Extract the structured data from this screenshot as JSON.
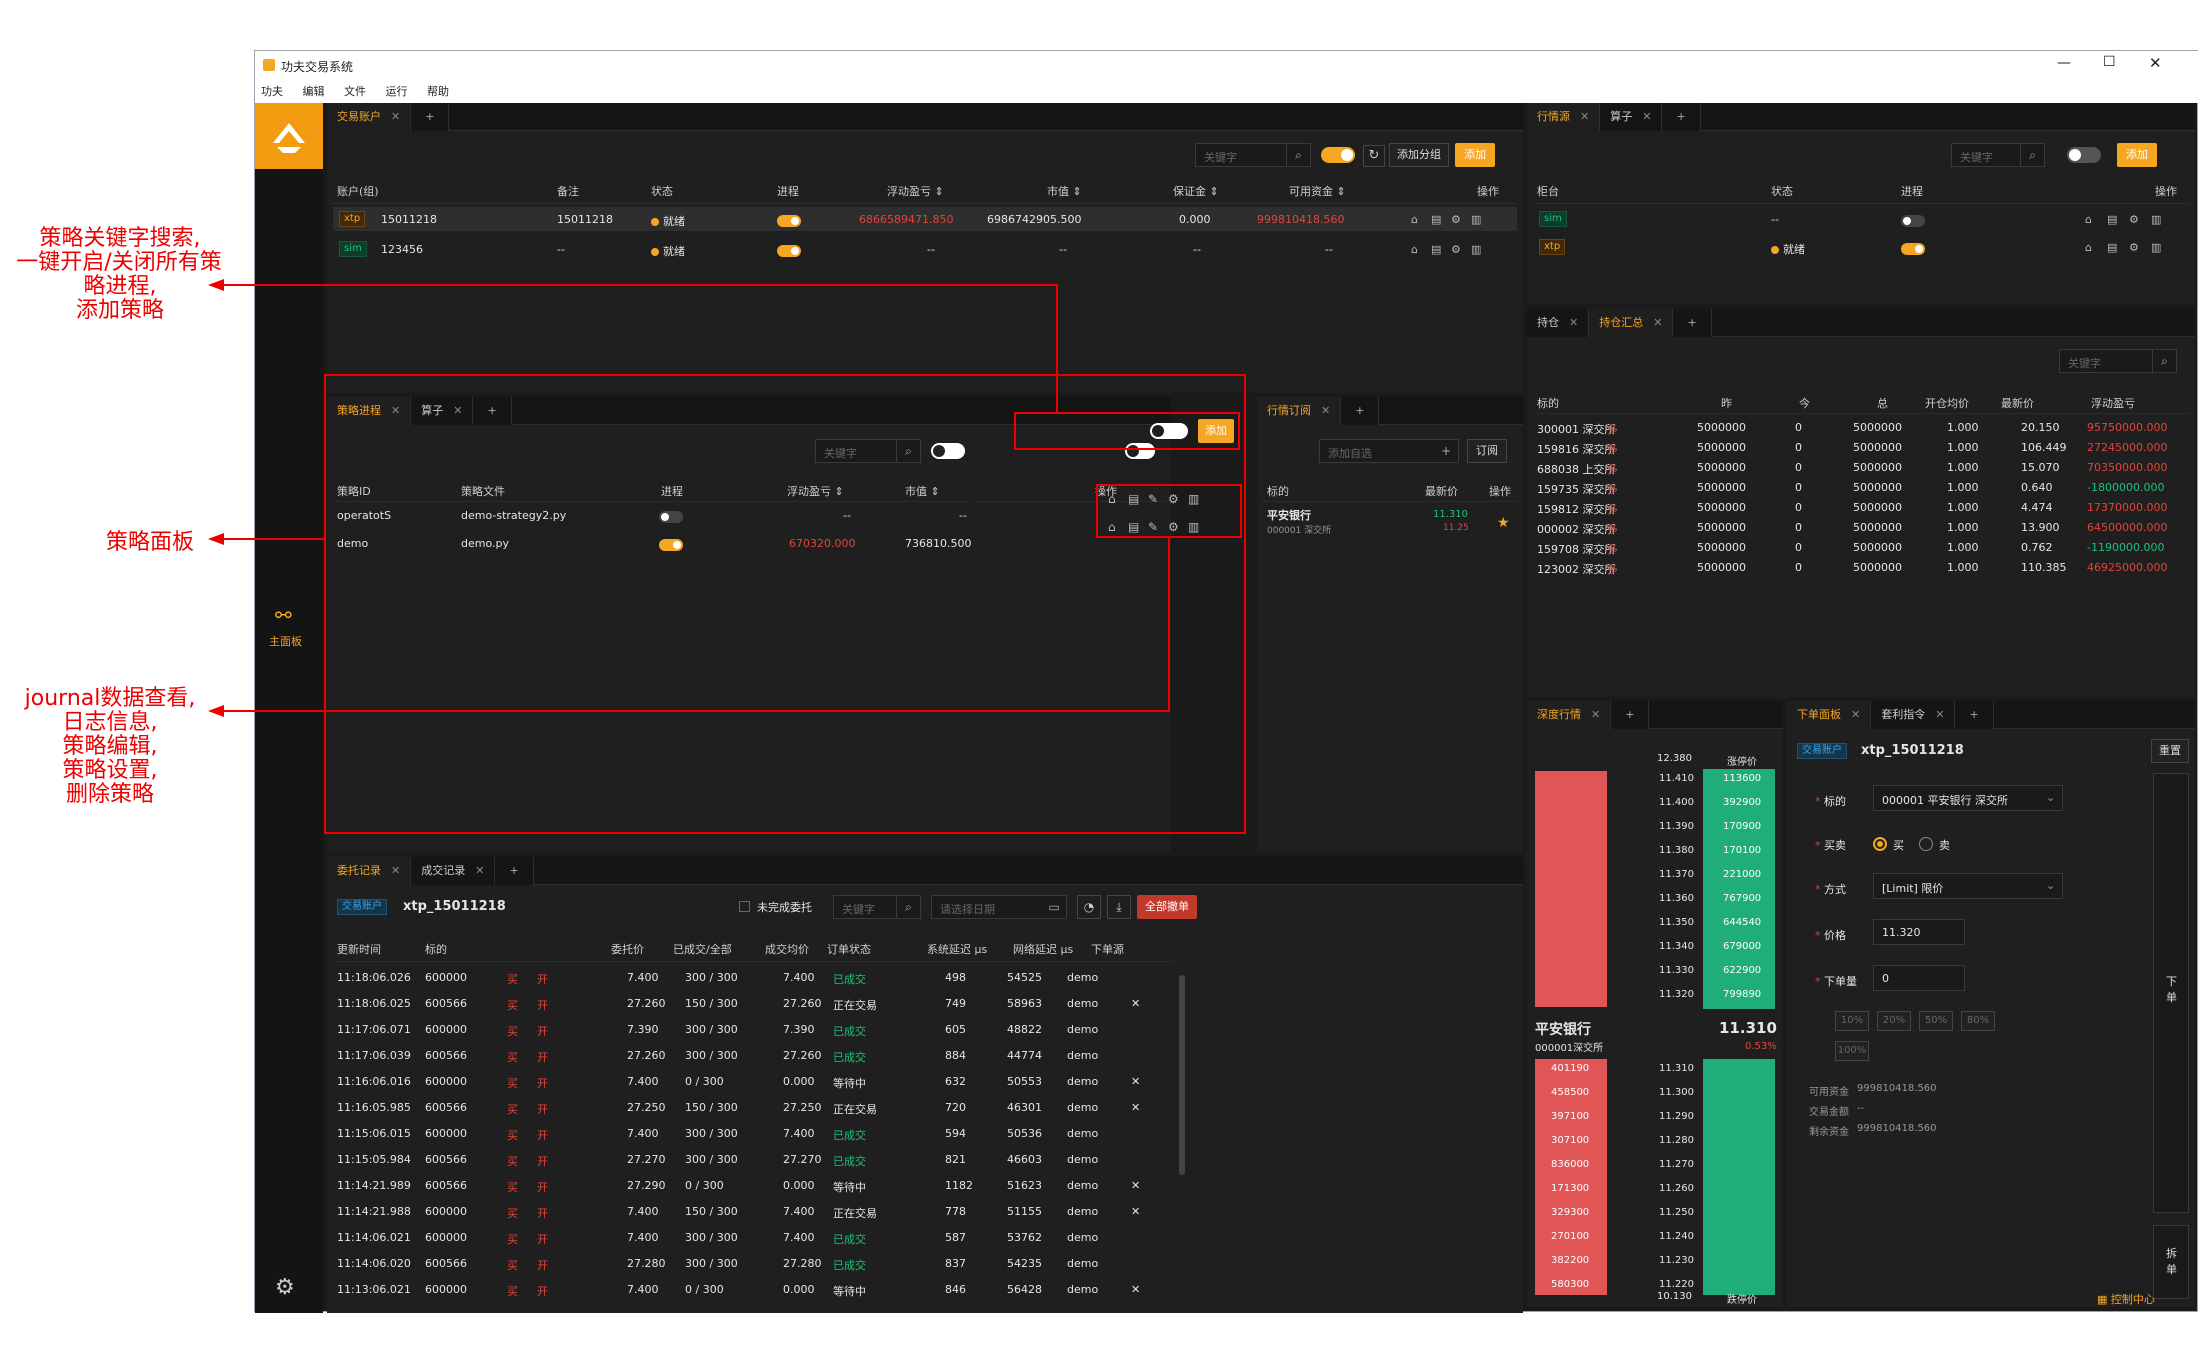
{
  "window": {
    "title": "功夫交易系统",
    "menu": [
      "功夫",
      "编辑",
      "文件",
      "运行",
      "帮助"
    ]
  },
  "sidebar": {
    "main_label": "主面板"
  },
  "accounts": {
    "tabs": [
      "交易账户",
      "+"
    ],
    "search_placeholder": "关键字",
    "add_group": "添加分组",
    "add": "添加",
    "columns": [
      "账户(组)",
      "备注",
      "状态",
      "进程",
      "浮动盈亏 ⇕",
      "市值 ⇕",
      "保证金 ⇕",
      "可用资金 ⇕",
      "操作"
    ],
    "rows": [
      {
        "tag": "xtp",
        "id": "15011218",
        "note": "15011218",
        "status": "就绪",
        "pnl": "6866589471.850",
        "mv": "6986742905.500",
        "margin": "0.000",
        "avail": "999810418.560"
      },
      {
        "tag": "sim",
        "id": "123456",
        "note": "--",
        "status": "就绪",
        "pnl": "--",
        "mv": "--",
        "margin": "--",
        "avail": "--"
      }
    ]
  },
  "md_sources": {
    "tabs": [
      "行情源",
      "算子",
      "+"
    ],
    "search_placeholder": "关键字",
    "add": "添加",
    "columns": [
      "柜台",
      "状态",
      "进程",
      "操作"
    ],
    "rows": [
      {
        "tag": "sim",
        "status": "--"
      },
      {
        "tag": "xtp",
        "status": "就绪"
      }
    ]
  },
  "strategy": {
    "tabs": [
      "策略进程",
      "算子",
      "+"
    ],
    "search_placeholder": "关键字",
    "add": "添加",
    "columns": [
      "策略ID",
      "策略文件",
      "进程",
      "浮动盈亏 ⇕",
      "市值 ⇕",
      "操作"
    ],
    "rows": [
      {
        "id": "operatotS",
        "file": "demo-strategy2.py",
        "pnl": "--",
        "mv": "--"
      },
      {
        "id": "demo",
        "file": "demo.py",
        "pnl": "670320.000",
        "mv": "736810.500"
      }
    ]
  },
  "subscription": {
    "tabs": [
      "行情订阅",
      "+"
    ],
    "add_placeholder": "添加自选",
    "subscribe": "订阅",
    "columns": [
      "标的",
      "最新价",
      "操作"
    ],
    "row": {
      "name": "平安银行",
      "code": "000001 深交所",
      "price": "11.310",
      "pct": "11.25"
    }
  },
  "positions": {
    "tabs": [
      "持仓",
      "持仓汇总",
      "+"
    ],
    "search_placeholder": "关键字",
    "columns": [
      "标的",
      "昨",
      "今",
      "总",
      "开仓均价",
      "最新价",
      "浮动盈亏"
    ],
    "rows": [
      {
        "sym": "300001 深交所",
        "side": "多",
        "y": "5000000",
        "t": "0",
        "total": "5000000",
        "avg": "1.000",
        "last": "20.150",
        "pnl": "95750000.000"
      },
      {
        "sym": "159816 深交所",
        "side": "多",
        "y": "5000000",
        "t": "0",
        "total": "5000000",
        "avg": "1.000",
        "last": "106.449",
        "pnl": "27245000.000"
      },
      {
        "sym": "688038 上交所",
        "side": "多",
        "y": "5000000",
        "t": "0",
        "total": "5000000",
        "avg": "1.000",
        "last": "15.070",
        "pnl": "70350000.000"
      },
      {
        "sym": "159735 深交所",
        "side": "多",
        "y": "5000000",
        "t": "0",
        "total": "5000000",
        "avg": "1.000",
        "last": "0.640",
        "pnl": "-1800000.000"
      },
      {
        "sym": "159812 深交所",
        "side": "多",
        "y": "5000000",
        "t": "0",
        "total": "5000000",
        "avg": "1.000",
        "last": "4.474",
        "pnl": "17370000.000"
      },
      {
        "sym": "000002 深交所",
        "side": "多",
        "y": "5000000",
        "t": "0",
        "total": "5000000",
        "avg": "1.000",
        "last": "13.900",
        "pnl": "64500000.000"
      },
      {
        "sym": "159708 深交所",
        "side": "多",
        "y": "5000000",
        "t": "0",
        "total": "5000000",
        "avg": "1.000",
        "last": "0.762",
        "pnl": "-1190000.000"
      },
      {
        "sym": "123002 深交所",
        "side": "多",
        "y": "5000000",
        "t": "0",
        "total": "5000000",
        "avg": "1.000",
        "last": "110.385",
        "pnl": "46925000.000"
      }
    ]
  },
  "orders": {
    "tabs": [
      "委托记录",
      "成交记录",
      "+"
    ],
    "account_tag": "交易账户",
    "account": "xtp_15011218",
    "unfinished": "未完成委托",
    "search_placeholder": "关键字",
    "date_placeholder": "请选择日期",
    "cancel_all": "全部撤单",
    "columns": [
      "更新时间",
      "标的",
      "委托价",
      "已成交/全部",
      "成交均价",
      "订单状态",
      "系统延迟 μs",
      "网络延迟 μs",
      "下单源"
    ],
    "rows": [
      {
        "time": "11:18:06.026",
        "sym": "600000",
        "price": "7.400",
        "fill": "300 / 300",
        "avg": "7.400",
        "status": "已成交",
        "sys": "498",
        "net": "54525",
        "src": "demo",
        "x": ""
      },
      {
        "time": "11:18:06.025",
        "sym": "600566",
        "price": "27.260",
        "fill": "150 / 300",
        "avg": "27.260",
        "status": "正在交易",
        "sys": "749",
        "net": "58963",
        "src": "demo",
        "x": "✕"
      },
      {
        "time": "11:17:06.071",
        "sym": "600000",
        "price": "7.390",
        "fill": "300 / 300",
        "avg": "7.390",
        "status": "已成交",
        "sys": "605",
        "net": "48822",
        "src": "demo",
        "x": ""
      },
      {
        "time": "11:17:06.039",
        "sym": "600566",
        "price": "27.260",
        "fill": "300 / 300",
        "avg": "27.260",
        "status": "已成交",
        "sys": "884",
        "net": "44774",
        "src": "demo",
        "x": ""
      },
      {
        "time": "11:16:06.016",
        "sym": "600000",
        "price": "7.400",
        "fill": "0 / 300",
        "avg": "0.000",
        "status": "等待中",
        "sys": "632",
        "net": "50553",
        "src": "demo",
        "x": "✕"
      },
      {
        "time": "11:16:05.985",
        "sym": "600566",
        "price": "27.250",
        "fill": "150 / 300",
        "avg": "27.250",
        "status": "正在交易",
        "sys": "720",
        "net": "46301",
        "src": "demo",
        "x": "✕"
      },
      {
        "time": "11:15:06.015",
        "sym": "600000",
        "price": "7.400",
        "fill": "300 / 300",
        "avg": "7.400",
        "status": "已成交",
        "sys": "594",
        "net": "50536",
        "src": "demo",
        "x": ""
      },
      {
        "time": "11:15:05.984",
        "sym": "600566",
        "price": "27.270",
        "fill": "300 / 300",
        "avg": "27.270",
        "status": "已成交",
        "sys": "821",
        "net": "46603",
        "src": "demo",
        "x": ""
      },
      {
        "time": "11:14:21.989",
        "sym": "600566",
        "price": "27.290",
        "fill": "0 / 300",
        "avg": "0.000",
        "status": "等待中",
        "sys": "1182",
        "net": "51623",
        "src": "demo",
        "x": "✕"
      },
      {
        "time": "11:14:21.988",
        "sym": "600000",
        "price": "7.400",
        "fill": "150 / 300",
        "avg": "7.400",
        "status": "正在交易",
        "sys": "778",
        "net": "51155",
        "src": "demo",
        "x": "✕"
      },
      {
        "time": "11:14:06.021",
        "sym": "600000",
        "price": "7.400",
        "fill": "300 / 300",
        "avg": "7.400",
        "status": "已成交",
        "sys": "587",
        "net": "53762",
        "src": "demo",
        "x": ""
      },
      {
        "time": "11:14:06.020",
        "sym": "600566",
        "price": "27.280",
        "fill": "300 / 300",
        "avg": "27.280",
        "status": "已成交",
        "sys": "837",
        "net": "54235",
        "src": "demo",
        "x": ""
      },
      {
        "time": "11:13:06.021",
        "sym": "600000",
        "price": "7.400",
        "fill": "0 / 300",
        "avg": "0.000",
        "status": "等待中",
        "sys": "846",
        "net": "56428",
        "src": "demo",
        "x": "✕"
      }
    ],
    "buy": "买",
    "open": "开"
  },
  "depth": {
    "tabs": [
      "深度行情",
      "+"
    ],
    "upper_label": "涨停价",
    "lower_label": "跌停价",
    "upper_price": "12.380",
    "lower_price": "10.130",
    "asks": [
      {
        "p": "11.410",
        "v": "113600"
      },
      {
        "p": "11.400",
        "v": "392900"
      },
      {
        "p": "11.390",
        "v": "170900"
      },
      {
        "p": "11.380",
        "v": "170100"
      },
      {
        "p": "11.370",
        "v": "221000"
      },
      {
        "p": "11.360",
        "v": "767900"
      },
      {
        "p": "11.350",
        "v": "644540"
      },
      {
        "p": "11.340",
        "v": "679000"
      },
      {
        "p": "11.330",
        "v": "622900"
      },
      {
        "p": "11.320",
        "v": "799890"
      }
    ],
    "bids": [
      {
        "p": "11.310",
        "v": "401190"
      },
      {
        "p": "11.300",
        "v": "458500"
      },
      {
        "p": "11.290",
        "v": "397100"
      },
      {
        "p": "11.280",
        "v": "307100"
      },
      {
        "p": "11.270",
        "v": "836000"
      },
      {
        "p": "11.260",
        "v": "171300"
      },
      {
        "p": "11.250",
        "v": "329300"
      },
      {
        "p": "11.240",
        "v": "270100"
      },
      {
        "p": "11.230",
        "v": "382200"
      },
      {
        "p": "11.220",
        "v": "580300"
      }
    ],
    "name": "平安银行",
    "code": "000001深交所",
    "last": "11.310",
    "pct": "0.53%"
  },
  "order_panel": {
    "tabs": [
      "下单面板",
      "套利指令",
      "+"
    ],
    "account_tag": "交易账户",
    "account": "xtp_15011218",
    "reset": "重置",
    "sym_label": "标的",
    "sym_value": "000001 平安银行 深交所",
    "side_label": "买卖",
    "buy": "买",
    "sell": "卖",
    "type_label": "方式",
    "type_value": "[Limit] 限价",
    "price_label": "价格",
    "price_value": "11.320",
    "qty_label": "下单量",
    "qty_value": "0",
    "pcts": [
      "10%",
      "20%",
      "50%",
      "80%",
      "100%"
    ],
    "avail_label": "可用资金",
    "avail_value": "999810418.560",
    "amount_label": "交易金额",
    "amount_value": "--",
    "remain_label": "剩余资金",
    "remain_value": "999810418.560",
    "submit": "下单",
    "split": "拆单"
  },
  "footer": {
    "control": "控制中心"
  },
  "annotations": {
    "a1": [
      "策略关键字搜索,",
      "一键开启/关闭所有策",
      "略进程,",
      "添加策略"
    ],
    "a2": "策略面板",
    "a3": [
      "journal数据查看,",
      "日志信息,",
      "策略编辑,",
      "策略设置,",
      "删除策略"
    ]
  },
  "colors": {
    "accent": "#f5a623",
    "up": "#e0453c",
    "down": "#1fc17a",
    "annotation": "#e00000"
  }
}
